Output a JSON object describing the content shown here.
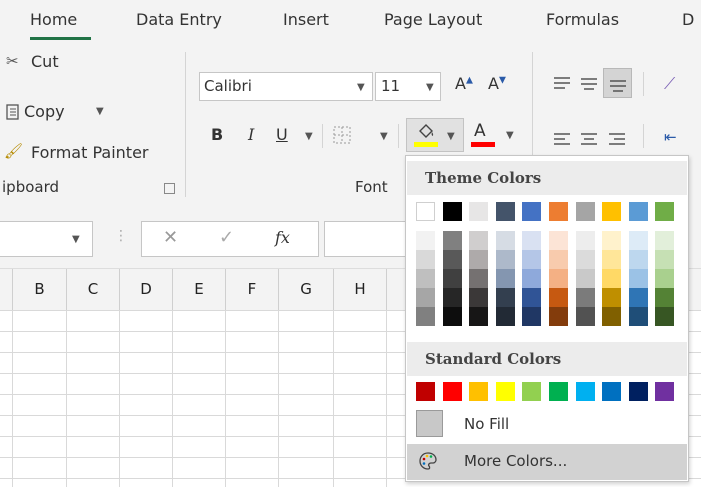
{
  "tabs": [
    "Home",
    "Data Entry",
    "Insert",
    "Page Layout",
    "Formulas",
    "D"
  ],
  "clipboard": {
    "cut_label": "Cut",
    "copy_label": "Copy",
    "format_painter_label": "Format Painter",
    "group_label": "ipboard"
  },
  "font": {
    "font_name": "Calibri",
    "font_size": "11",
    "bold": "B",
    "italic": "I",
    "underline": "U",
    "font_color_letter": "A",
    "group_label": "Font",
    "grow_label": "A",
    "shrink_label": "A"
  },
  "formula_bar": {
    "fx_label": "fx"
  },
  "columns": [
    "B",
    "C",
    "D",
    "E",
    "F",
    "G",
    "H"
  ],
  "color_menu": {
    "theme_title": "Theme Colors",
    "standard_title": "Standard Colors",
    "no_fill_label": "No Fill",
    "more_colors_label": "More Colors...",
    "theme_top_row": [
      "#FFFFFF",
      "#000000",
      "#E7E6E6",
      "#44546A",
      "#4472C4",
      "#ED7D31",
      "#A5A5A5",
      "#FFC000",
      "#5B9BD5",
      "#70AD47"
    ],
    "theme_shades": [
      [
        "#F2F2F2",
        "#D9D9D9",
        "#BFBFBF",
        "#A6A6A6",
        "#808080"
      ],
      [
        "#808080",
        "#595959",
        "#404040",
        "#262626",
        "#0D0D0D"
      ],
      [
        "#D0CECE",
        "#AEAAAA",
        "#757171",
        "#3B3838",
        "#171616"
      ],
      [
        "#D6DCE4",
        "#ADB9CA",
        "#8496B0",
        "#333F4F",
        "#222A35"
      ],
      [
        "#D9E1F2",
        "#B4C6E7",
        "#8EA9DB",
        "#305496",
        "#203764"
      ],
      [
        "#FCE4D6",
        "#F8CBAD",
        "#F4B084",
        "#C65911",
        "#833C0C"
      ],
      [
        "#EDEDED",
        "#DBDBDB",
        "#C9C9C9",
        "#7B7B7B",
        "#525252"
      ],
      [
        "#FFF2CC",
        "#FFE699",
        "#FFD966",
        "#BF8F00",
        "#806000"
      ],
      [
        "#DDEBF7",
        "#BDD7EE",
        "#9BC2E6",
        "#2F75B5",
        "#1F4E78"
      ],
      [
        "#E2EFDA",
        "#C6E0B4",
        "#A9D08E",
        "#548235",
        "#375623"
      ]
    ],
    "standard_colors": [
      "#C00000",
      "#FF0000",
      "#FFC000",
      "#FFFF00",
      "#92D050",
      "#00B050",
      "#00B0F0",
      "#0070C0",
      "#002060",
      "#7030A0"
    ]
  },
  "accent_color": "#217346"
}
